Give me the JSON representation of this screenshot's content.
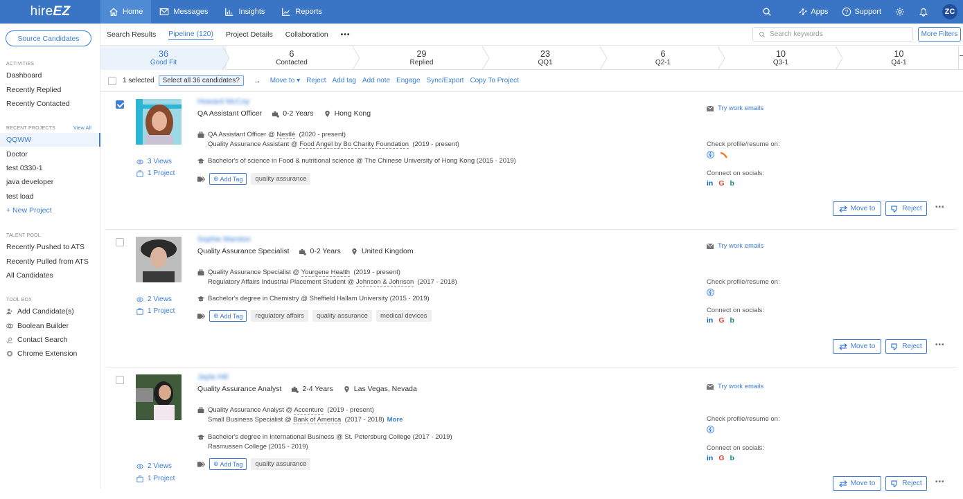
{
  "topbar": {
    "logo_plain": "hire",
    "logo_bold": "EZ",
    "nav": [
      {
        "label": "Home",
        "icon": "home-icon",
        "active": true
      },
      {
        "label": "Messages",
        "icon": "envelope-icon"
      },
      {
        "label": "Insights",
        "icon": "bar-chart-icon"
      },
      {
        "label": "Reports",
        "icon": "line-chart-icon"
      }
    ],
    "apps_label": "Apps",
    "support_label": "Support",
    "avatar_initials": "ZC"
  },
  "sidebar": {
    "source_button": "Source Candidates",
    "activities_heading": "ACTIVITIES",
    "activities": [
      "Dashboard",
      "Recently Replied",
      "Recently Contacted"
    ],
    "recent_projects_heading": "RECENT PROJECTS",
    "view_all": "View All",
    "projects": [
      "QQWW",
      "Doctor",
      "test 0330-1",
      "java developer",
      "test load"
    ],
    "active_project": "QQWW",
    "new_project": "+ New Project",
    "talent_pool_heading": "TALENT POOL",
    "talent_pool": [
      "Recently Pushed to ATS",
      "Recently Pulled from ATS",
      "All Candidates"
    ],
    "toolbox_heading": "TOOL BOX",
    "toolbox": [
      {
        "label": "Add Candidate(s)",
        "icon": "add-user-icon"
      },
      {
        "label": "Boolean Builder",
        "icon": "boolean-icon"
      },
      {
        "label": "Contact Search",
        "icon": "contact-search-icon"
      },
      {
        "label": "Chrome Extension",
        "icon": "chrome-icon"
      }
    ]
  },
  "subtabs": {
    "items": [
      "Search Results",
      "Pipeline (120)",
      "Project Details",
      "Collaboration"
    ],
    "active": "Pipeline (120)",
    "more": "•••",
    "search_placeholder": "Search keywords",
    "search_value": "",
    "more_filters": "More Filters"
  },
  "stages": [
    {
      "count": "36",
      "label": "Good Fit",
      "active": true
    },
    {
      "count": "6",
      "label": "Contacted"
    },
    {
      "count": "29",
      "label": "Replied"
    },
    {
      "count": "23",
      "label": "QQ1"
    },
    {
      "count": "6",
      "label": "Q2-1"
    },
    {
      "count": "10",
      "label": "Q3-1"
    },
    {
      "count": "10",
      "label": "Q4-1"
    }
  ],
  "actionbar": {
    "selected_text": "1 selected",
    "select_all": "Select all 36 candidates?",
    "arrow": "→",
    "actions": [
      "Move to ▾",
      "Reject",
      "Add tag",
      "Add note",
      "Engage",
      "Sync/Export",
      "Copy To Project"
    ]
  },
  "common": {
    "try_work_emails": "Try work emails",
    "check_profile": "Check profile/resume on:",
    "connect_socials": "Connect on socials:",
    "add_tag": "Add Tag",
    "move_to": "Move to",
    "reject": "Reject",
    "kebab": "•••",
    "social_linkedin": "in",
    "social_google": "G",
    "social_bing": "b"
  },
  "candidates": [
    {
      "name": "Howard McCoy",
      "checked": true,
      "title": "QA Assistant Officer",
      "experience": "0-2 Years",
      "location": "Hong Kong",
      "jobs": [
        {
          "role": "QA Assistant Officer @ ",
          "company": "Nestlé",
          "dates": "(2020 - present)"
        },
        {
          "role": "Quality Assurance Assistant @ ",
          "company": "Food Angel by Bo Charity Foundation",
          "dates": "(2019 - present)"
        }
      ],
      "education": [
        "Bachelor's of science in Food & nutritional science @ The Chinese University of Hong Kong (2015 - 2019)"
      ],
      "tags": [
        "quality assurance"
      ],
      "views": "3 Views",
      "projects": "1 Project",
      "profile_sources": [
        "hiretual",
        "other"
      ]
    },
    {
      "name": "Sophie Marston",
      "checked": false,
      "title": "Quality Assurance Specialist",
      "experience": "0-2 Years",
      "location": "United Kingdom",
      "jobs": [
        {
          "role": "Quality Assurance Specialist @ ",
          "company": "Yourgene Health",
          "dates": "(2019 - present)"
        },
        {
          "role": "Regulatory Affairs Industrial Placement Student @ ",
          "company": "Johnson & Johnson",
          "dates": "(2017 - 2018)"
        }
      ],
      "education": [
        "Bachelor's degree in Chemistry @ Sheffield Hallam University (2015 - 2019)"
      ],
      "tags": [
        "regulatory affairs",
        "quality assurance",
        "medical devices"
      ],
      "views": "2 Views",
      "projects": "1 Project",
      "profile_sources": [
        "hiretual"
      ]
    },
    {
      "name": "Jayla Hill",
      "checked": false,
      "title": "Quality Assurance Analyst",
      "experience": "2-4 Years",
      "location": "Las Vegas, Nevada",
      "jobs": [
        {
          "role": "Quality Assurance Analyst @ ",
          "company": "Accenture",
          "dates": "(2019 - present)"
        },
        {
          "role": "Small Business Specialist @ ",
          "company": "Bank of America",
          "dates": "(2017 - 2018)",
          "more": "More"
        }
      ],
      "education": [
        "Bachelor's degree in International Business @ St. Petersburg College (2017 - 2019)",
        "Rasmussen College (2015 - 2019)"
      ],
      "tags": [
        "quality assurance"
      ],
      "views": "2 Views",
      "projects": "1 Project",
      "profile_sources": [
        "hiretual"
      ]
    }
  ],
  "colors": {
    "brand": "#3a74c4",
    "accent": "#3b7dd8",
    "linkedin": "#0a66c2",
    "google": "#db4437",
    "bing": "#1b8a7a"
  }
}
